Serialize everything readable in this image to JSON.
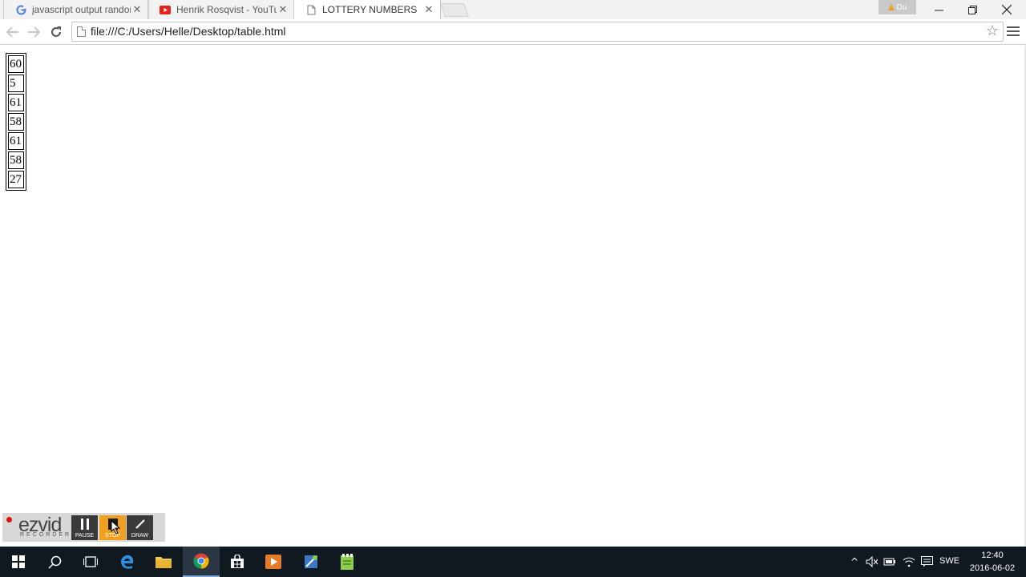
{
  "browser": {
    "tabs": [
      {
        "label": "javascript output random",
        "icon": "google-icon"
      },
      {
        "label": "Henrik Rosqvist - YouTube",
        "icon": "youtube-icon"
      },
      {
        "label": "LOTTERY NUMBERS",
        "icon": "page-icon",
        "active": true
      }
    ],
    "profile_label": "Du",
    "url": "file:///C:/Users/Helle/Desktop/table.html"
  },
  "page": {
    "numbers": [
      "60",
      "5",
      "61",
      "58",
      "61",
      "58",
      "27"
    ]
  },
  "ezvid": {
    "logo": "ezvid",
    "logo_sub": "RECORDER",
    "buttons": {
      "pause": "PAUSE",
      "stop": "STOP",
      "draw": "DRAW"
    }
  },
  "taskbar": {
    "language": "SWE",
    "time": "12:40",
    "date": "2016-06-02"
  },
  "colors": {
    "taskbar_bg": "#101820",
    "ezvid_stop": "#f0a020",
    "record_dot": "#e01010"
  }
}
